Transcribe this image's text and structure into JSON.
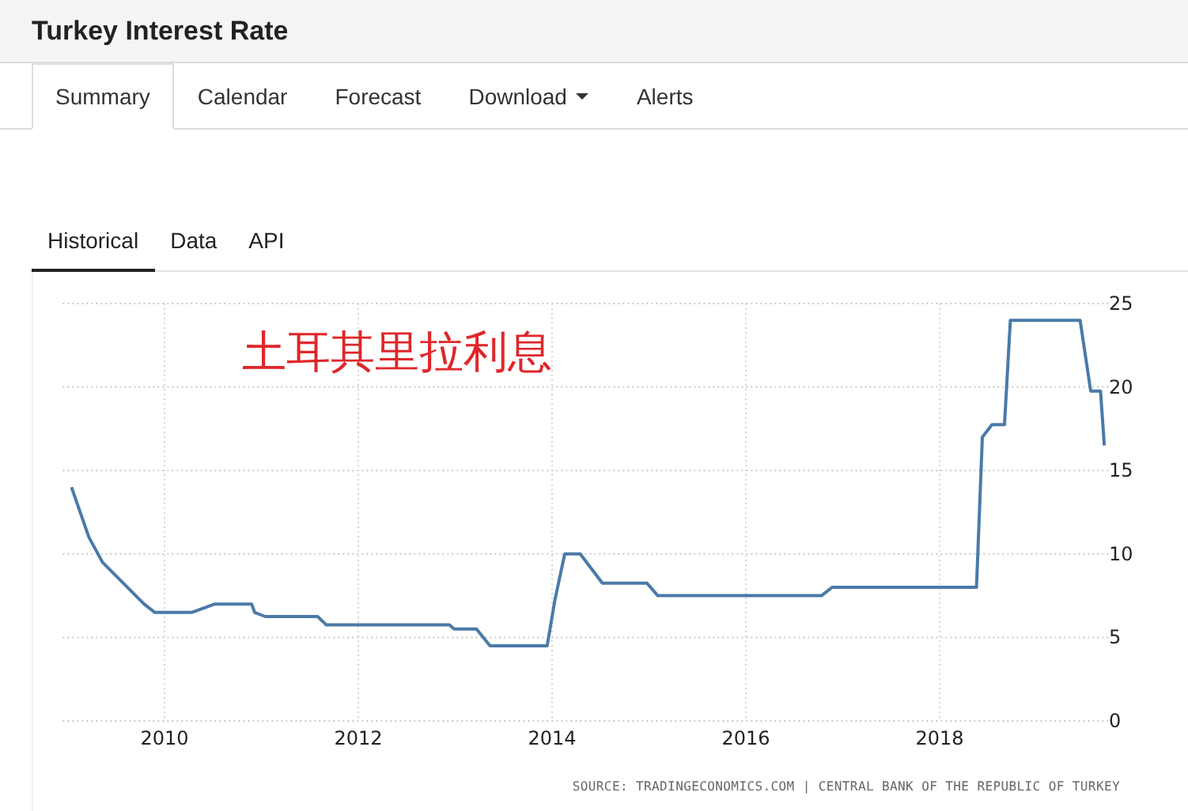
{
  "header": {
    "title": "Turkey Interest Rate"
  },
  "tabs": [
    {
      "label": "Summary",
      "selected": true,
      "dropdown": false
    },
    {
      "label": "Calendar",
      "selected": false,
      "dropdown": false
    },
    {
      "label": "Forecast",
      "selected": false,
      "dropdown": false
    },
    {
      "label": "Download",
      "selected": false,
      "dropdown": true
    },
    {
      "label": "Alerts",
      "selected": false,
      "dropdown": false
    }
  ],
  "subtabs": [
    {
      "label": "Historical",
      "selected": true
    },
    {
      "label": "Data",
      "selected": false
    },
    {
      "label": "API",
      "selected": false
    }
  ],
  "chart": {
    "annotation": "土耳其里拉利息",
    "source": "SOURCE: TRADINGECONOMICS.COM | CENTRAL BANK OF THE REPUBLIC OF TURKEY",
    "chart_data": {
      "type": "line",
      "x": [
        2009.04,
        2009.22,
        2009.36,
        2009.79,
        2009.9,
        2010.28,
        2010.52,
        2010.9,
        2010.93,
        2011.04,
        2011.58,
        2011.67,
        2012.94,
        2012.99,
        2013.22,
        2013.36,
        2013.95,
        2014.03,
        2014.13,
        2014.29,
        2014.52,
        2014.98,
        2015.09,
        2016.78,
        2016.89,
        2018.38,
        2018.44,
        2018.54,
        2018.67,
        2018.73,
        2019.45,
        2019.56,
        2019.66,
        2019.7
      ],
      "series": [
        {
          "color": "#4a7aa8",
          "values": [
            14,
            11,
            9.5,
            7,
            6.5,
            6.5,
            7,
            7,
            6.5,
            6.25,
            6.25,
            5.75,
            5.75,
            5.5,
            5.5,
            4.5,
            4.5,
            7.25,
            10,
            10,
            8.25,
            8.25,
            7.5,
            7.5,
            8,
            8,
            17,
            17.75,
            17.75,
            24,
            24,
            19.75,
            19.75,
            16.5
          ]
        }
      ],
      "grid": true,
      "xlim": [
        2008.95,
        2019.75
      ],
      "ylim": [
        0,
        25
      ],
      "xticks": [
        2010,
        2012,
        2014,
        2016,
        2018
      ],
      "yticks": [
        0,
        5,
        10,
        15,
        20,
        25
      ]
    }
  }
}
